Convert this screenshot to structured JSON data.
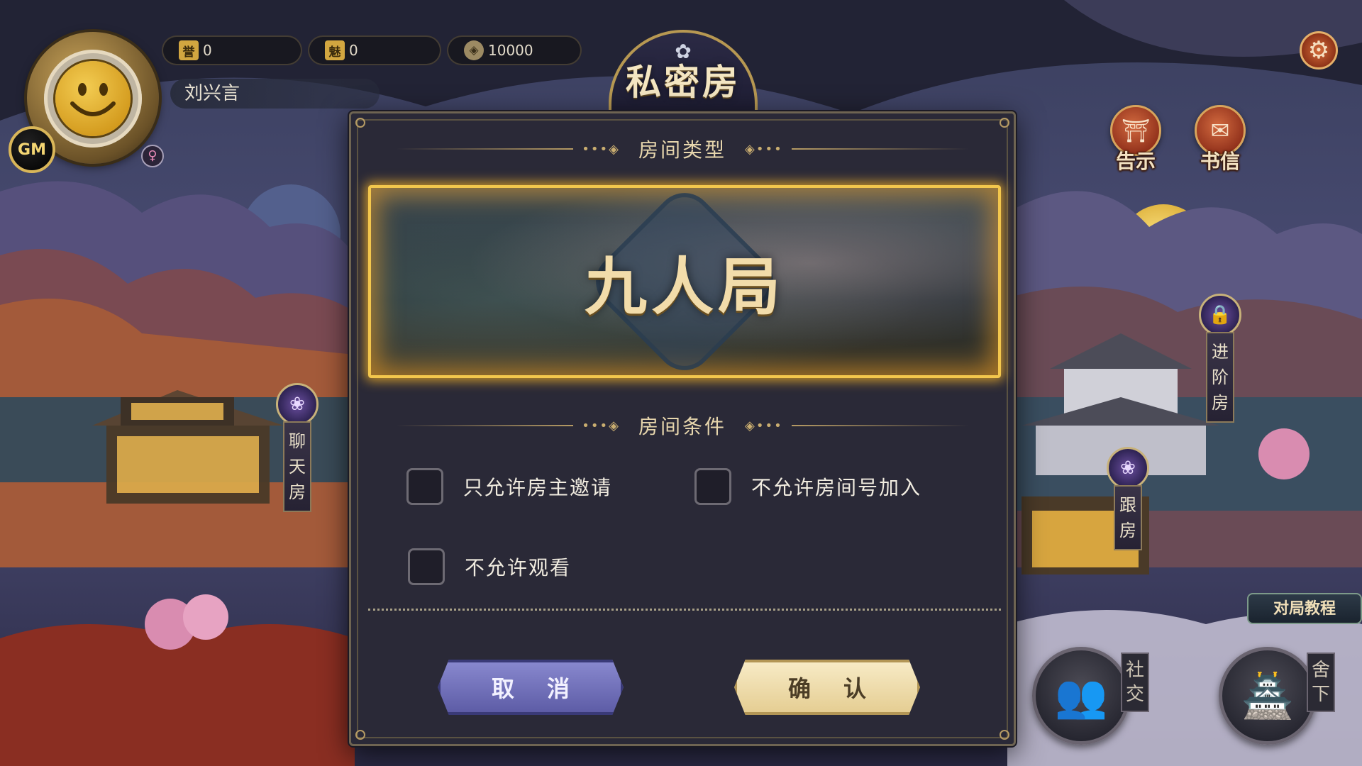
{
  "player": {
    "name": "刘兴言",
    "gm_badge": "GM",
    "gender_icon": "♀",
    "honor_icon": "誉",
    "honor": "0",
    "charm_icon": "魅",
    "charm": "0",
    "coins": "10000"
  },
  "title": "私密房",
  "top_right": {
    "settings_icon": "gear-icon",
    "notice_label": "告示",
    "letter_label": "书信"
  },
  "map_tags": {
    "chat_room": "聊天房",
    "advanced_room": "进阶房",
    "follow_room": "跟房"
  },
  "bottom_right": {
    "tutorial": "对局教程",
    "social": "社交",
    "home": "舍下"
  },
  "dialog": {
    "room_type_header": "房间类型",
    "room_type": "九人局",
    "conditions_header": "房间条件",
    "options": [
      {
        "label": "只允许房主邀请",
        "checked": false
      },
      {
        "label": "不允许房间号加入",
        "checked": false
      },
      {
        "label": "不允许观看",
        "checked": false
      }
    ],
    "cancel_label": "取消",
    "confirm_label": "确认"
  },
  "colors": {
    "accent_gold": "#f3c74d",
    "cancel_purple": "#6e6db8",
    "confirm_cream": "#efdba8",
    "dialog_bg": "#2a2937"
  }
}
